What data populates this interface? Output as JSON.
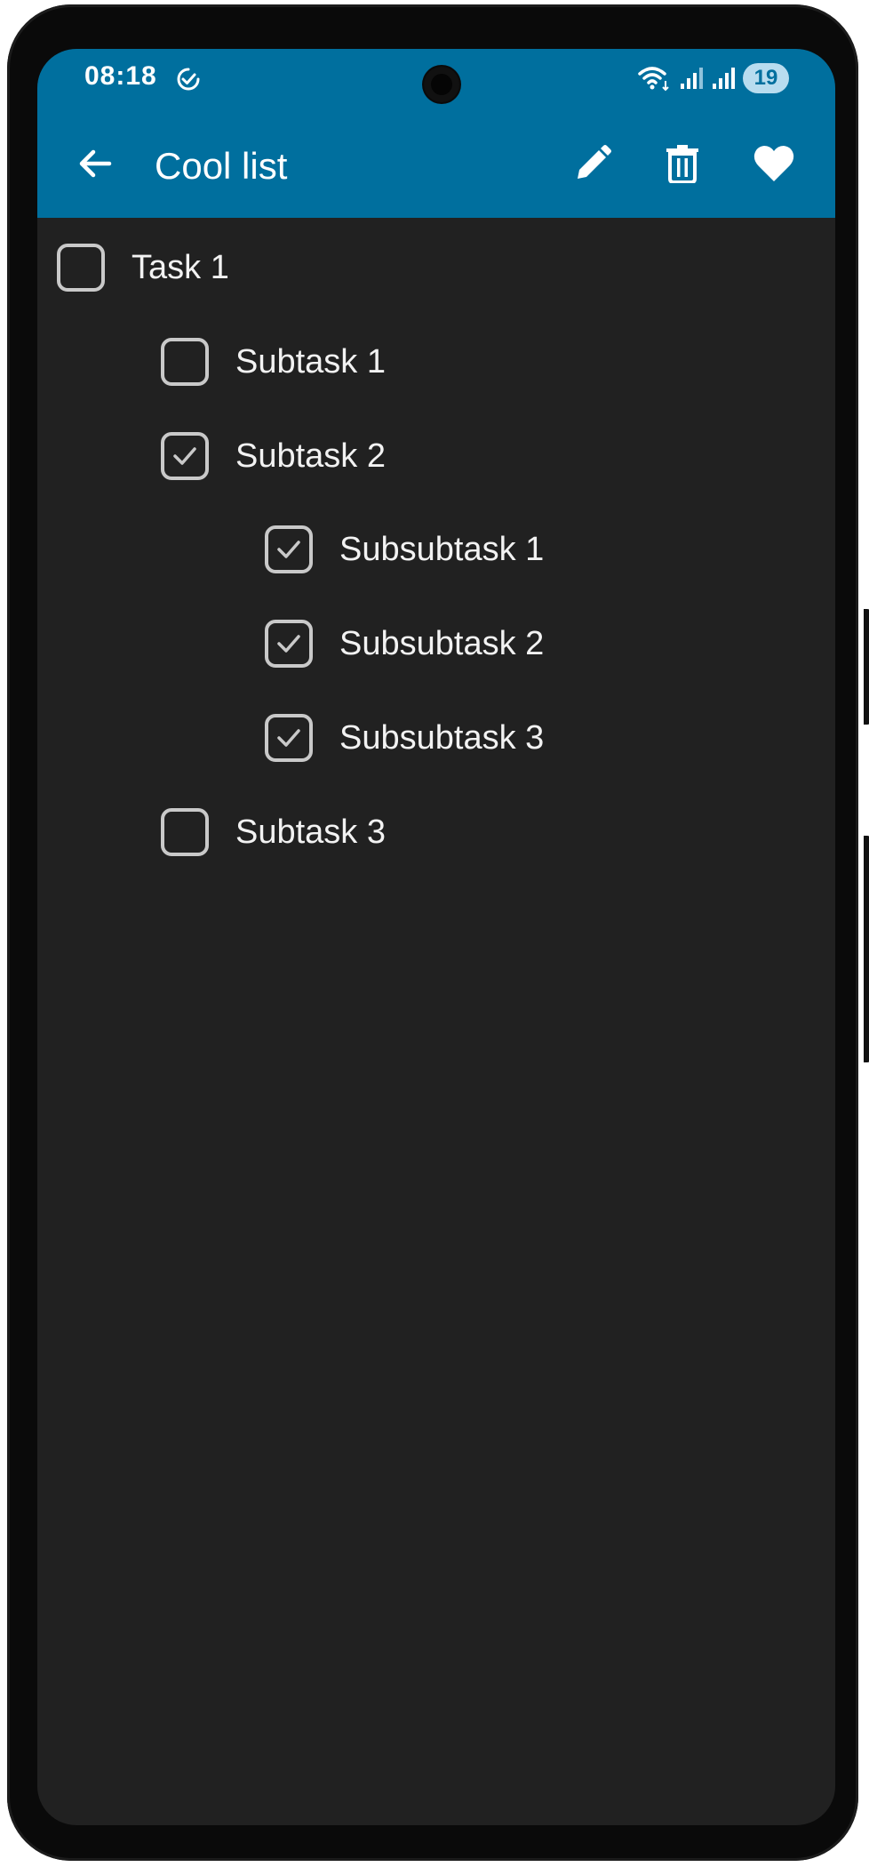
{
  "status_bar": {
    "time": "08:18",
    "battery": "19",
    "icons": [
      "check-circle-icon",
      "wifi-icon",
      "signal-icon",
      "signal-icon"
    ]
  },
  "app_bar": {
    "title": "Cool list",
    "back_icon": "arrow-back-icon",
    "actions": [
      "edit-icon",
      "delete-icon",
      "favorite-icon"
    ]
  },
  "tasks": [
    {
      "label": "Task 1",
      "checked": false,
      "level": 0
    },
    {
      "label": "Subtask 1",
      "checked": false,
      "level": 1
    },
    {
      "label": "Subtask 2",
      "checked": true,
      "level": 1
    },
    {
      "label": "Subsubtask 1",
      "checked": true,
      "level": 2
    },
    {
      "label": "Subsubtask 2",
      "checked": true,
      "level": 2
    },
    {
      "label": "Subsubtask 3",
      "checked": true,
      "level": 2
    },
    {
      "label": "Subtask 3",
      "checked": false,
      "level": 1
    }
  ],
  "colors": {
    "app_bar": "#006f9e",
    "background": "#212121",
    "checkbox_border": "#c9c9c9",
    "text": "#f2f2f2"
  }
}
